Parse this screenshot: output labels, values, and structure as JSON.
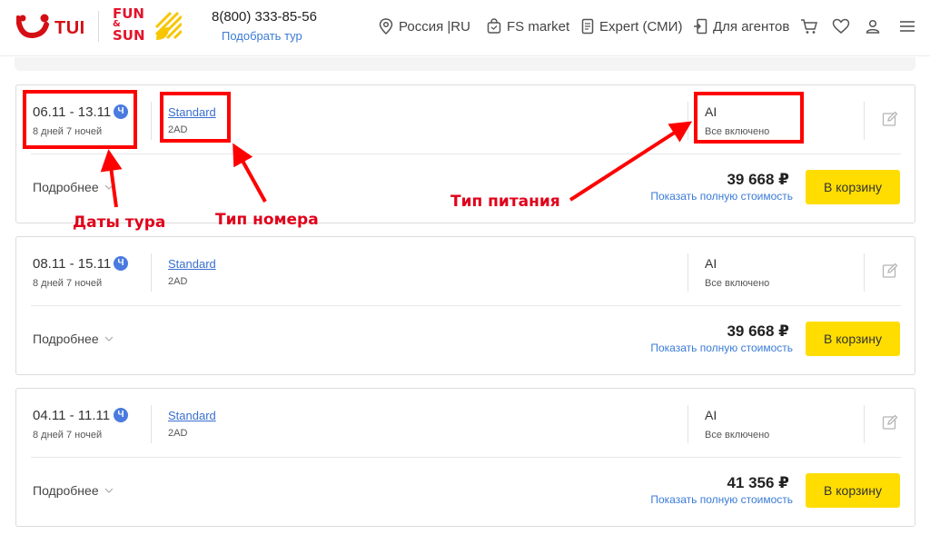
{
  "header": {
    "brand_tui": "TUI",
    "brand_fs_line1": "FUN",
    "brand_fs_amp": "&",
    "brand_fs_line2": "SUN",
    "phone": "8(800) 333-85-56",
    "pick_tour": "Подобрать тур",
    "nav": [
      {
        "label": "Россия |RU",
        "icon": "location-pin-icon"
      },
      {
        "label": "FS market",
        "icon": "shopping-bag-icon"
      },
      {
        "label": "Expert (СМИ)",
        "icon": "document-icon"
      },
      {
        "label": "Для агентов",
        "icon": "agent-door-icon"
      }
    ],
    "icons": [
      "cart-icon",
      "heart-icon",
      "user-icon",
      "menu-icon"
    ]
  },
  "offers": [
    {
      "dates": "06.11 - 13.11",
      "badge": "Ч",
      "nights": "8 дней 7 ночей",
      "room": "Standard",
      "room_code": "2AD",
      "meal": "AI",
      "meal_desc": "Все включено",
      "more": "Подробнее",
      "price": "39 668 ₽",
      "full_cost": "Показать полную стоимость",
      "cart": "В корзину"
    },
    {
      "dates": "08.11 - 15.11",
      "badge": "Ч",
      "nights": "8 дней 7 ночей",
      "room": "Standard",
      "room_code": "2AD",
      "meal": "AI",
      "meal_desc": "Все включено",
      "more": "Подробнее",
      "price": "39 668 ₽",
      "full_cost": "Показать полную стоимость",
      "cart": "В корзину"
    },
    {
      "dates": "04.11 - 11.11",
      "badge": "Ч",
      "nights": "8 дней 7 ночей",
      "room": "Standard",
      "room_code": "2AD",
      "meal": "AI",
      "meal_desc": "Все включено",
      "more": "Подробнее",
      "price": "41 356 ₽",
      "full_cost": "Показать полную стоимость",
      "cart": "В корзину"
    }
  ],
  "annotations": {
    "tour_dates": "Даты тура",
    "room_type": "Тип номера",
    "meal_type": "Тип питания",
    "color": "#ff0000"
  },
  "colors": {
    "brand_red": "#d40e14",
    "link_blue": "#3a7bd5",
    "button_yellow": "#ffdd00",
    "badge_blue": "#4a7be0"
  }
}
